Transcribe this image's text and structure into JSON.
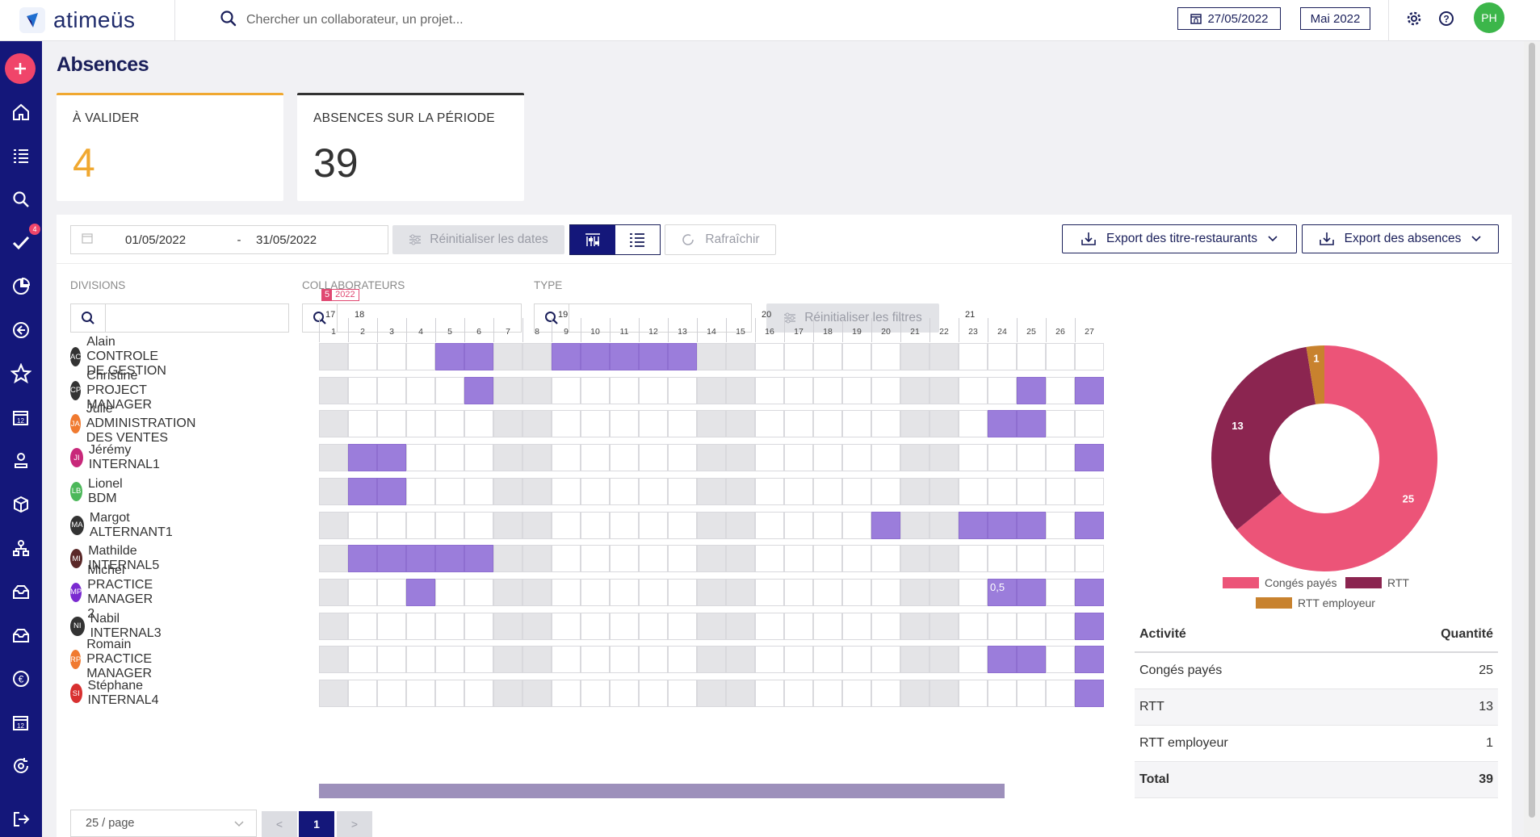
{
  "app": {
    "brand": "atimeüs"
  },
  "topbar": {
    "search_placeholder": "Chercher un collaborateur, un projet...",
    "date_button": "27/05/2022",
    "month_button": "Mai 2022",
    "user_initials": "PH",
    "user_color": "#3cb64a"
  },
  "sidebar": {
    "items": [
      "plus-icon",
      "home-icon",
      "list-icon",
      "search-icon",
      "check-icon",
      "chart-hand-icon",
      "arrow-left-circle-icon",
      "star-icon",
      "calendar-12-icon",
      "user-stamp-icon",
      "cube-icon",
      "org-chart-icon",
      "inbox-icon",
      "inbox-alt-icon",
      "euro-icon",
      "calendar-12-alt-icon",
      "recycle-icon",
      "logout-icon"
    ],
    "validation_badge": "4"
  },
  "page": {
    "title": "Absences"
  },
  "cards": [
    {
      "label": "À VALIDER",
      "value": "4",
      "accent": "#f0a830"
    },
    {
      "label": "ABSENCES SUR LA PÉRIODE",
      "value": "39",
      "accent": "#333333"
    }
  ],
  "toolbar": {
    "date_start": "01/05/2022",
    "date_sep": "-",
    "date_end": "31/05/2022",
    "reset_dates": "Réinitialiser les dates",
    "refresh": "Rafraîchir",
    "export_tr": "Export des titre-restaurants",
    "export_abs": "Export des absences"
  },
  "filters": {
    "divisions_label": "DIVISIONS",
    "collaborateurs_label": "COLLABORATEURS",
    "type_label": "TYPE",
    "reset_filters": "Réinitialiser les filtres"
  },
  "calendar": {
    "month_flag_num": "5",
    "month_flag_year": "2022",
    "weeks": [
      {
        "label": "17",
        "day_index": 0
      },
      {
        "label": "18",
        "day_index": 1
      },
      {
        "label": "19",
        "day_index": 8
      },
      {
        "label": "20",
        "day_index": 15
      },
      {
        "label": "21",
        "day_index": 22
      }
    ],
    "days": [
      "1",
      "2",
      "3",
      "4",
      "5",
      "6",
      "7",
      "8",
      "9",
      "10",
      "11",
      "12",
      "13",
      "14",
      "15",
      "16",
      "17",
      "18",
      "19",
      "20",
      "21",
      "22",
      "23",
      "24",
      "25",
      "26",
      "27"
    ],
    "weekend_days": [
      1,
      7,
      8,
      14,
      15,
      21,
      22
    ]
  },
  "rows": [
    {
      "initials": "AC",
      "name": "Alain CONTROLE DE GESTION",
      "color": "#333333",
      "absences": [
        5,
        6,
        9,
        10,
        11,
        12,
        13
      ]
    },
    {
      "initials": "CP",
      "name": "Christine PROJECT MANAGER",
      "color": "#333333",
      "absences": [
        6,
        25,
        27
      ]
    },
    {
      "initials": "JA",
      "name": "Julie ADMINISTRATION DES VENTES",
      "color": "#f07a30",
      "absences": [
        24,
        25
      ]
    },
    {
      "initials": "JI",
      "name": "Jérémy INTERNAL1",
      "color": "#c8287a",
      "absences": [
        2,
        3,
        27
      ]
    },
    {
      "initials": "LB",
      "name": "Lionel BDM",
      "color": "#4cb85a",
      "absences": [
        2,
        3
      ]
    },
    {
      "initials": "MA",
      "name": "Margot ALTERNANT1",
      "color": "#333333",
      "absences": [
        20,
        23,
        24,
        25,
        27
      ]
    },
    {
      "initials": "MI",
      "name": "Mathilde INTERNAL5",
      "color": "#5a2828",
      "absences": [
        2,
        3,
        4,
        5,
        6
      ]
    },
    {
      "initials": "MP",
      "name": "Michel PRACTICE MANAGER 2",
      "color": "#7a2ad0",
      "absences": [
        4,
        24,
        25,
        27
      ],
      "cell_labels": {
        "24": "0,5"
      }
    },
    {
      "initials": "NI",
      "name": "Nabil INTERNAL3",
      "color": "#333333",
      "absences": [
        27
      ]
    },
    {
      "initials": "RP",
      "name": "Romain PRACTICE MANAGER",
      "color": "#f07a30",
      "absences": [
        24,
        25,
        27
      ]
    },
    {
      "initials": "SI",
      "name": "Stéphane INTERNAL4",
      "color": "#d83030",
      "absences": [
        27
      ]
    }
  ],
  "pager": {
    "size": "25 / page",
    "prev": "<",
    "current": "1",
    "next": ">"
  },
  "chart_data": {
    "type": "pie",
    "donut": true,
    "categories": [
      "Congés payés",
      "RTT",
      "RTT employeur"
    ],
    "values": [
      25,
      13,
      1
    ],
    "colors": [
      "#ec5478",
      "#8b2550",
      "#c8822e"
    ],
    "legend": "bottom"
  },
  "summary": {
    "header_activity": "Activité",
    "header_qty": "Quantité",
    "rows": [
      {
        "label": "Congés payés",
        "value": "25"
      },
      {
        "label": "RTT",
        "value": "13"
      },
      {
        "label": "RTT employeur",
        "value": "1"
      }
    ],
    "total_label": "Total",
    "total_value": "39"
  }
}
